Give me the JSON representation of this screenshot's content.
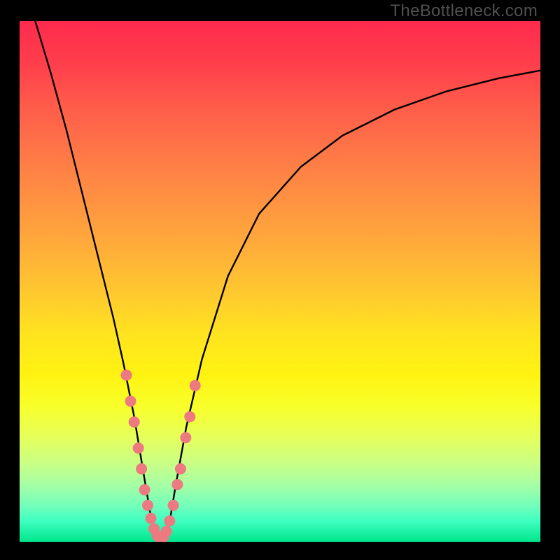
{
  "watermark": "TheBottleneck.com",
  "chart_data": {
    "type": "line",
    "title": "",
    "xlabel": "",
    "ylabel": "",
    "xlim": [
      0,
      100
    ],
    "ylim": [
      0,
      100
    ],
    "gradient_stops": [
      {
        "pct": 0,
        "color": "#ff2a4d"
      },
      {
        "pct": 50,
        "color": "#ffe31f"
      },
      {
        "pct": 100,
        "color": "#00e58c"
      }
    ],
    "series": [
      {
        "name": "bottleneck-curve",
        "color": "#000000",
        "x": [
          3,
          6,
          9,
          12,
          15,
          18,
          20,
          22,
          23.5,
          25,
          26,
          27,
          28,
          29,
          30,
          32,
          35,
          40,
          46,
          54,
          62,
          72,
          82,
          92,
          100
        ],
        "y": [
          100,
          90,
          79,
          67,
          55,
          43,
          34,
          24,
          15,
          6,
          1,
          0,
          1,
          5,
          11,
          22,
          35,
          51,
          63,
          72,
          78,
          83,
          86.5,
          89,
          90.5
        ]
      }
    ],
    "markers": {
      "name": "data-points",
      "color": "#ec7a80",
      "radius": 8,
      "points": [
        {
          "x": 20.5,
          "y": 32
        },
        {
          "x": 21.3,
          "y": 27
        },
        {
          "x": 22.0,
          "y": 23
        },
        {
          "x": 22.8,
          "y": 18
        },
        {
          "x": 23.4,
          "y": 14
        },
        {
          "x": 24.0,
          "y": 10
        },
        {
          "x": 24.6,
          "y": 7
        },
        {
          "x": 25.2,
          "y": 4.5
        },
        {
          "x": 25.8,
          "y": 2.5
        },
        {
          "x": 26.4,
          "y": 1.2
        },
        {
          "x": 27.0,
          "y": 0.5
        },
        {
          "x": 27.6,
          "y": 0.8
        },
        {
          "x": 28.2,
          "y": 2
        },
        {
          "x": 28.8,
          "y": 4
        },
        {
          "x": 29.5,
          "y": 7
        },
        {
          "x": 30.3,
          "y": 11
        },
        {
          "x": 30.9,
          "y": 14
        },
        {
          "x": 31.9,
          "y": 20
        },
        {
          "x": 32.7,
          "y": 24
        },
        {
          "x": 33.7,
          "y": 30
        }
      ]
    }
  }
}
